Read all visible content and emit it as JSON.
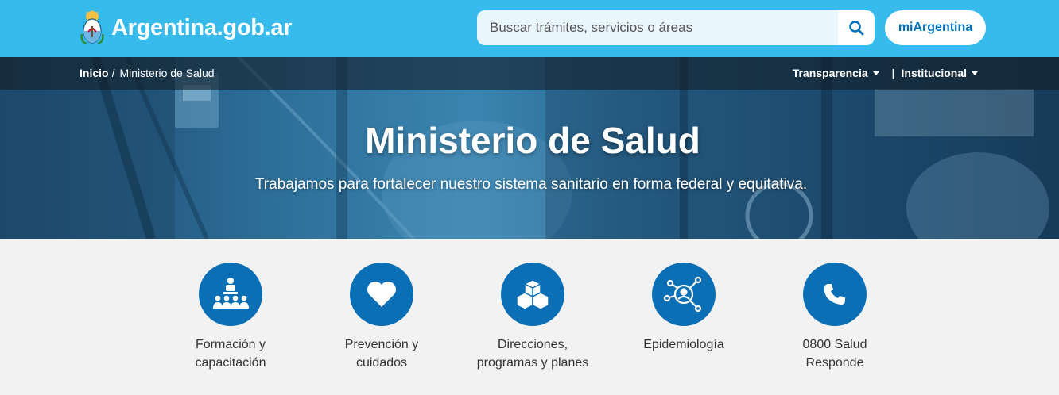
{
  "header": {
    "brand": "Argentina.gob.ar",
    "search_placeholder": "Buscar trámites, servicios o áreas",
    "mi_argentina": "miArgentina"
  },
  "breadcrumb": {
    "home": "Inicio",
    "separator": "/",
    "current": "Ministerio de Salud"
  },
  "hero_menu": {
    "transparencia": "Transparencia",
    "separator": "|",
    "institucional": "Institucional"
  },
  "hero": {
    "title": "Ministerio de Salud",
    "subtitle": "Trabajamos para fortalecer nuestro sistema sanitario en forma federal y equitativa."
  },
  "cards": [
    {
      "line1": "Formación y",
      "line2": "capacitación",
      "icon": "training-icon"
    },
    {
      "line1": "Prevención y",
      "line2": "cuidados",
      "icon": "heart-icon"
    },
    {
      "line1": "Direcciones,",
      "line2": "programas y planes",
      "icon": "boxes-icon"
    },
    {
      "line1": "Epidemiología",
      "line2": "",
      "icon": "network-person-icon"
    },
    {
      "line1": "0800 Salud",
      "line2": "Responde",
      "icon": "phone-icon"
    }
  ],
  "colors": {
    "topbar": "#37bbed",
    "brand_blue": "#0072bb",
    "icon_circle": "#0b6fb6"
  }
}
